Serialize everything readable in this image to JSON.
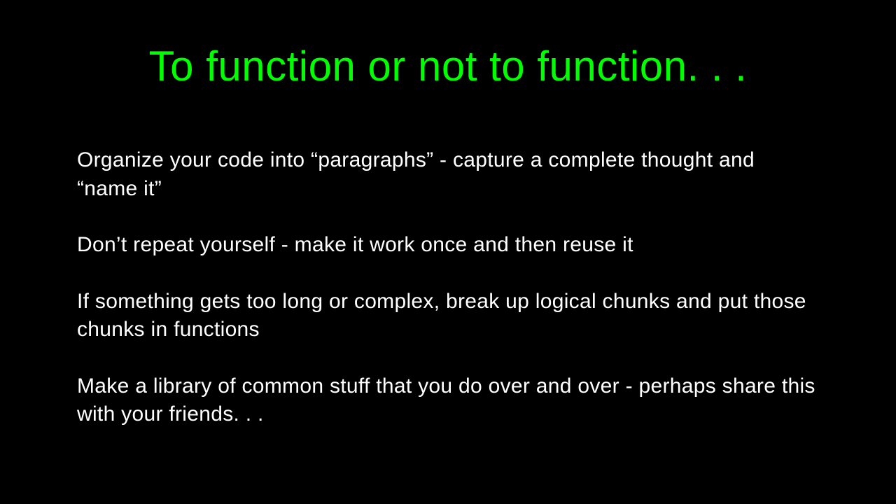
{
  "slide": {
    "title": "To function or not to function. . .",
    "bullets": [
      "Organize your code into “paragraphs” - capture a complete thought and “name it”",
      "Don’t repeat yourself - make it work once and then reuse it",
      "If something gets too long or complex, break up logical chunks and put those chunks in functions",
      "Make a library of common stuff that you do over and over - perhaps share this with your friends. . ."
    ]
  }
}
